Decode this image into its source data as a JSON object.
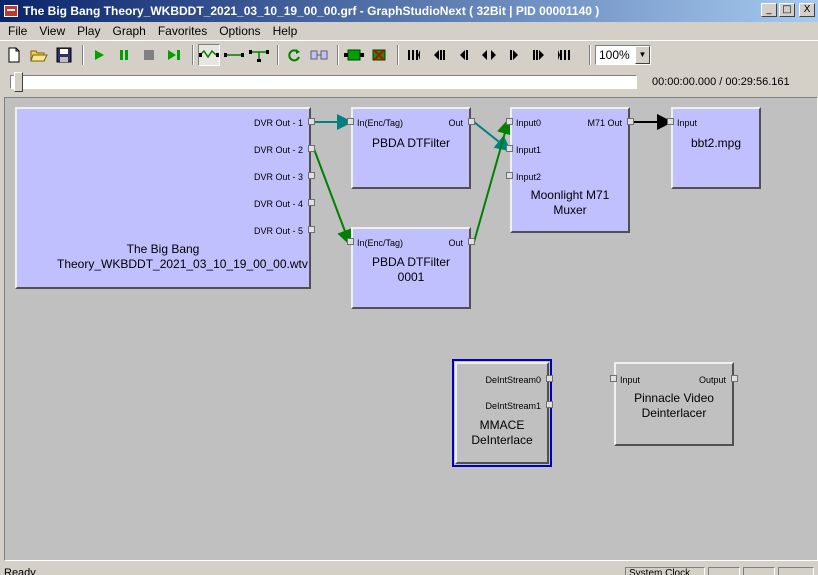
{
  "window": {
    "title": "The Big Bang Theory_WKBDDT_2021_03_10_19_00_00.grf - GraphStudioNext ( 32Bit | PID 00001140 )",
    "buttons": [
      "_",
      "□",
      "X"
    ]
  },
  "menu": [
    "File",
    "View",
    "Play",
    "Graph",
    "Favorites",
    "Options",
    "Help"
  ],
  "toolbar": {
    "icons": [
      "new-file-icon",
      "open-folder-icon",
      "save-icon",
      "play-icon",
      "pause-icon",
      "stop-icon",
      "frame-step-icon",
      "graph-connect-icon",
      "graph-direct-icon",
      "graph-render-icon",
      "refresh-icon",
      "layout-icon",
      "add-filter-icon",
      "remove-filter-icon",
      "seek-start-icon",
      "seek-back-big-icon",
      "seek-back-icon",
      "seek-prev-icon",
      "seek-next-icon",
      "seek-forward-icon",
      "seek-forward-big-icon",
      "seek-end-icon"
    ],
    "zoom": "100%"
  },
  "seek": {
    "time": "00:00:00.000 / 00:29:56.161"
  },
  "filters": {
    "source": {
      "name": "The Big Bang Theory_WKBDDT_2021_03_10_19_00_00.wtv",
      "pins": [
        "DVR Out - 1",
        "DVR Out - 2",
        "DVR Out - 3",
        "DVR Out - 4",
        "DVR Out - 5"
      ]
    },
    "dtfilter1": {
      "name": "PBDA DTFilter",
      "in": "In(Enc/Tag)",
      "out": "Out"
    },
    "dtfilter2": {
      "name": "PBDA DTFilter 0001",
      "in": "In(Enc/Tag)",
      "out": "Out"
    },
    "muxer": {
      "name": "Moonlight M71 Muxer",
      "inputs": [
        "Input0",
        "Input1",
        "Input2"
      ],
      "out": "M71 Out"
    },
    "writer": {
      "name": "bbt2.mpg",
      "in": "Input"
    },
    "mmace": {
      "name": "MMACE DeInterlace",
      "outputs": [
        "DeIntStream0",
        "DeIntStream1"
      ]
    },
    "pinnacle": {
      "name": "Pinnacle Video Deinterlacer",
      "in": "Input",
      "out": "Output"
    }
  },
  "colors": {
    "link_teal": "#008080",
    "link_green": "#008000",
    "link_black": "#000000",
    "filter_blue": "#c0c0ff",
    "selection": "#0000c0"
  },
  "status": {
    "text": "Ready",
    "panels": [
      "System Clock"
    ]
  }
}
